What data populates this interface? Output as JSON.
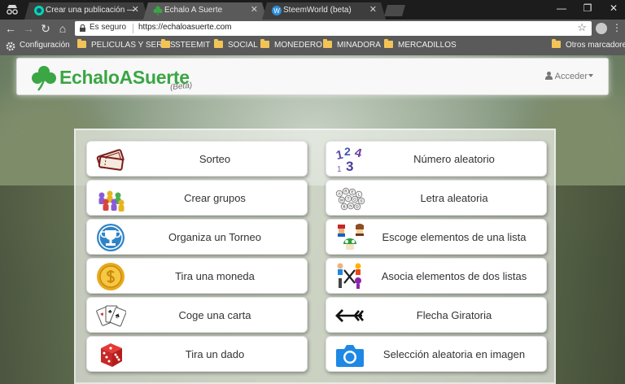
{
  "browser": {
    "tabs": [
      {
        "title": "Crear una publicación — ",
        "active": false
      },
      {
        "title": "Echalo A Suerte",
        "active": true
      },
      {
        "title": "SteemWorld (beta)",
        "active": false
      }
    ],
    "address": {
      "secure_label": "Es seguro",
      "url": "https://echaloasuerte.com"
    },
    "bookmarks": {
      "settings": "Configuración",
      "folders": [
        "PELICULAS Y SERIES",
        "STEEMIT",
        "SOCIAL",
        "MONEDERO",
        "MINADORA",
        "MERCADILLOS"
      ],
      "other": "Otros marcadores"
    }
  },
  "site": {
    "brand": {
      "name": "EchaloASuerte",
      "tag": "(Beta)",
      "color": "#3aa644"
    },
    "login_label": "Acceder"
  },
  "tiles": {
    "left": [
      {
        "label": "Sorteo",
        "icon": "ticket-icon"
      },
      {
        "label": "Crear grupos",
        "icon": "groups-icon"
      },
      {
        "label": "Organiza un Torneo",
        "icon": "trophy-icon"
      },
      {
        "label": "Tira una moneda",
        "icon": "coin-icon"
      },
      {
        "label": "Coge una carta",
        "icon": "cards-icon"
      },
      {
        "label": "Tira un dado",
        "icon": "dice-icon"
      }
    ],
    "right": [
      {
        "label": "Número aleatorio",
        "icon": "numbers-icon"
      },
      {
        "label": "Letra aleatoria",
        "icon": "letters-icon"
      },
      {
        "label": "Escoge elementos de una lista",
        "icon": "list-items-icon"
      },
      {
        "label": "Asocia elementos de dos listas",
        "icon": "associate-icon"
      },
      {
        "label": "Flecha Giratoria",
        "icon": "arrow-icon"
      },
      {
        "label": "Selección aleatoria en imagen",
        "icon": "camera-icon"
      }
    ]
  }
}
